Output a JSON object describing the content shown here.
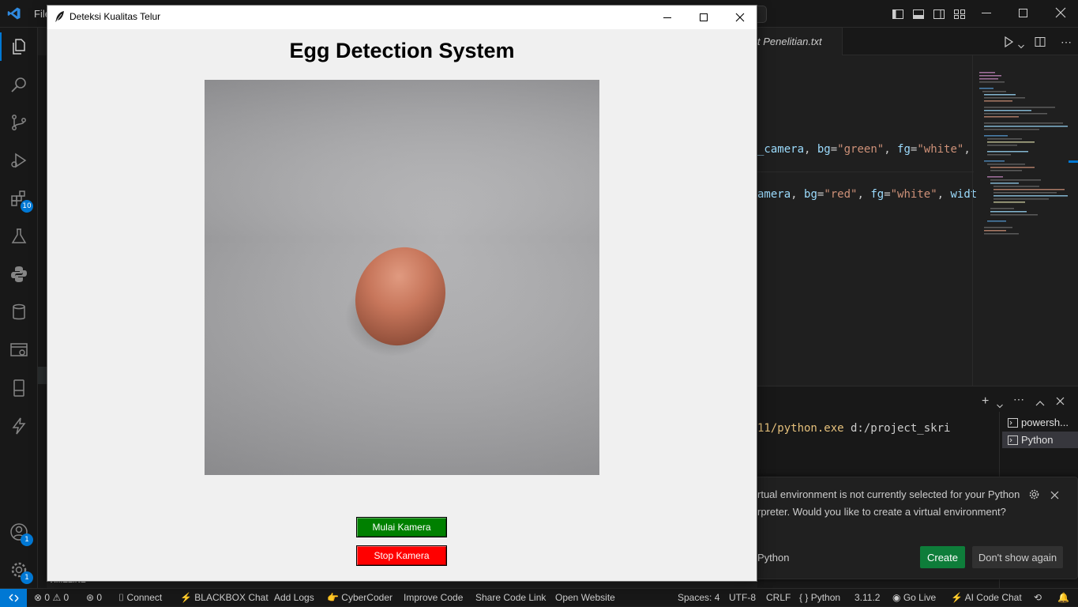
{
  "vscode": {
    "menu_label": "File",
    "tab_partial_title": "t Penelitian.txt",
    "code_line_1": {
      "a": "_camera",
      "b": ", ",
      "c": "bg",
      "d": "=",
      "e": "\"green\"",
      "f": ", ",
      "g": "fg",
      "h": "=",
      "i": "\"white\"",
      "j": ","
    },
    "code_line_2": {
      "a": "amera",
      "b": ", ",
      "c": "bg",
      "d": "=",
      "e": "\"red\"",
      "f": ", ",
      "g": "fg",
      "h": "=",
      "i": "\"white\"",
      "j": ", ",
      "k": "widt"
    },
    "terminal_line": {
      "a": "11/python.exe",
      "b": " d:/project_skri"
    },
    "terminal_tabs": [
      "powersh...",
      "Python"
    ],
    "activity_badges": {
      "extensions": "10",
      "accounts": "1",
      "manage": "1"
    },
    "notification": {
      "line1": "rtual environment is not currently selected for your Python",
      "line2": "rpreter. Would you like to create a virtual environment?",
      "source": "Python",
      "create_label": "Create",
      "dismiss_label": "Don't show again"
    },
    "timeline_label": "TIMELINE",
    "statusbar": {
      "errors": "0",
      "warnings": "0",
      "ports": "0",
      "connect": "Connect",
      "blackbox": "BLACKBOX Chat",
      "add_logs": "Add Logs",
      "cybercoder": "CyberCoder",
      "improve": "Improve Code",
      "share": "Share Code Link",
      "open_website": "Open Website",
      "spaces": "Spaces: 4",
      "encoding": "UTF-8",
      "eol": "CRLF",
      "language": "Python",
      "version": "3.11.2",
      "golive": "Go Live",
      "ai_chat": "AI Code Chat"
    }
  },
  "app": {
    "window_title": "Deteksi Kualitas Telur",
    "heading": "Egg Detection System",
    "start_button": "Mulai Kamera",
    "stop_button": "Stop Kamera",
    "colors": {
      "start": "#008000",
      "stop": "#ff0000",
      "button_text": "#ffffff"
    }
  }
}
